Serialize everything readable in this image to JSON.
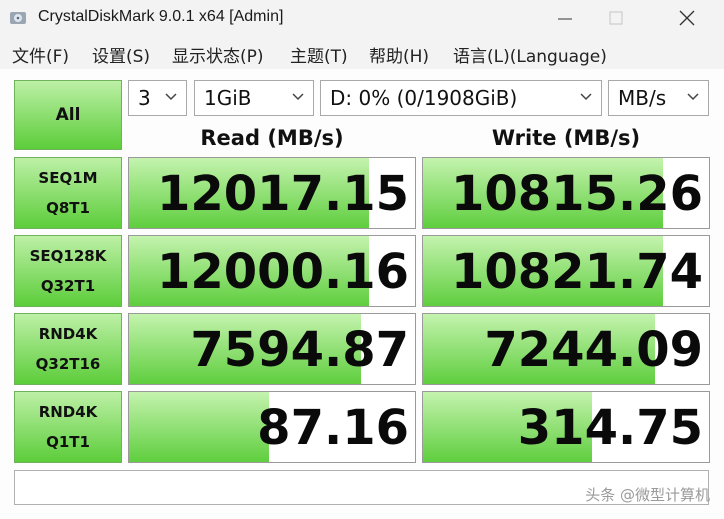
{
  "window": {
    "title": "CrystalDiskMark 9.0.1 x64 [Admin]"
  },
  "menu": [
    "文件(F)",
    "设置(S)",
    "显示状态(P)",
    "主题(T)",
    "帮助(H)",
    "语言(L)(Language)"
  ],
  "controls": {
    "all_label": "All",
    "count": "3",
    "size": "1GiB",
    "drive": "D: 0% (0/1908GiB)",
    "unit": "MB/s"
  },
  "headers": {
    "read": "Read (MB/s)",
    "write": "Write (MB/s)"
  },
  "tests": [
    {
      "line1": "SEQ1M",
      "line2": "Q8T1",
      "read": "12017.15",
      "write": "10815.26",
      "read_fill": 0.84,
      "write_fill": 0.84
    },
    {
      "line1": "SEQ128K",
      "line2": "Q32T1",
      "read": "12000.16",
      "write": "10821.74",
      "read_fill": 0.84,
      "write_fill": 0.84
    },
    {
      "line1": "RND4K",
      "line2": "Q32T16",
      "read": "7594.87",
      "write": "7244.09",
      "read_fill": 0.81,
      "write_fill": 0.81
    },
    {
      "line1": "RND4K",
      "line2": "Q1T1",
      "read": "87.16",
      "write": "314.75",
      "read_fill": 0.49,
      "write_fill": 0.59
    }
  ],
  "comment": "",
  "watermark": "头条 @微型计算机",
  "colors": {
    "green_top": "#c4f3ae",
    "green_bottom": "#5fce3e",
    "button_border": "#6fb25a"
  }
}
